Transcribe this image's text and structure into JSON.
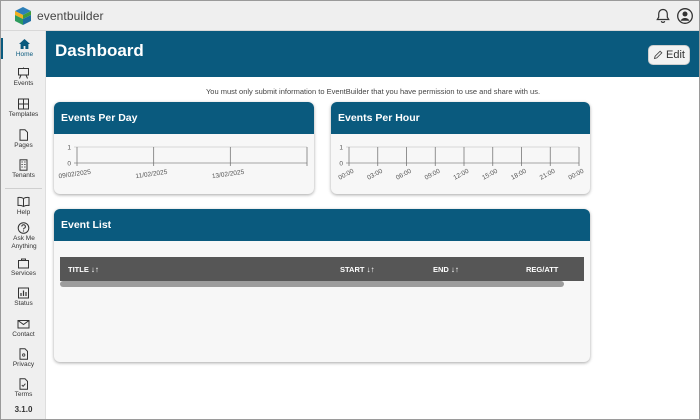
{
  "app": {
    "brand": "eventbuilder",
    "version": "3.1.0"
  },
  "topbar": {
    "icons": [
      "bell-icon",
      "user-circle-icon"
    ]
  },
  "sidebar": {
    "items": [
      {
        "label": "Home",
        "icon": "home-icon",
        "active": true
      },
      {
        "label": "Events",
        "icon": "easel-icon"
      },
      {
        "label": "Templates",
        "icon": "templates-icon"
      },
      {
        "label": "Pages",
        "icon": "page-icon"
      },
      {
        "label": "Tenants",
        "icon": "building-icon"
      },
      {
        "label": "Help",
        "icon": "book-icon"
      },
      {
        "label": "Ask Me Anything",
        "icon": "question-icon"
      },
      {
        "label": "Services",
        "icon": "bag-icon"
      },
      {
        "label": "Status",
        "icon": "status-chart-icon"
      },
      {
        "label": "Contact",
        "icon": "envelope-icon"
      },
      {
        "label": "Privacy",
        "icon": "privacy-doc-icon"
      },
      {
        "label": "Terms",
        "icon": "terms-doc-icon"
      }
    ]
  },
  "header": {
    "title": "Dashboard",
    "edit_label": "Edit"
  },
  "notice": "You must only submit information to EventBuilder that you have permission to use and share with us.",
  "colors": {
    "brand": "#0a5a7e",
    "table_header": "#565656"
  },
  "cards": {
    "per_day": {
      "title": "Events Per Day"
    },
    "per_hour": {
      "title": "Events Per Hour"
    },
    "event_list": {
      "title": "Event List",
      "columns": [
        "TITLE",
        "START",
        "END",
        "REG/ATT"
      ]
    }
  },
  "chart_data": [
    {
      "type": "line",
      "title": "Events Per Day",
      "x": [
        "09/02/2025",
        "11/02/2025",
        "13/02/2025"
      ],
      "yticks": [
        0,
        1
      ],
      "ylim": [
        0,
        1
      ]
    },
    {
      "type": "line",
      "title": "Events Per Hour",
      "x": [
        "00:00",
        "03:00",
        "06:00",
        "09:00",
        "12:00",
        "15:00",
        "18:00",
        "21:00",
        "00:00"
      ],
      "yticks": [
        0,
        1
      ],
      "ylim": [
        0,
        1
      ]
    }
  ]
}
